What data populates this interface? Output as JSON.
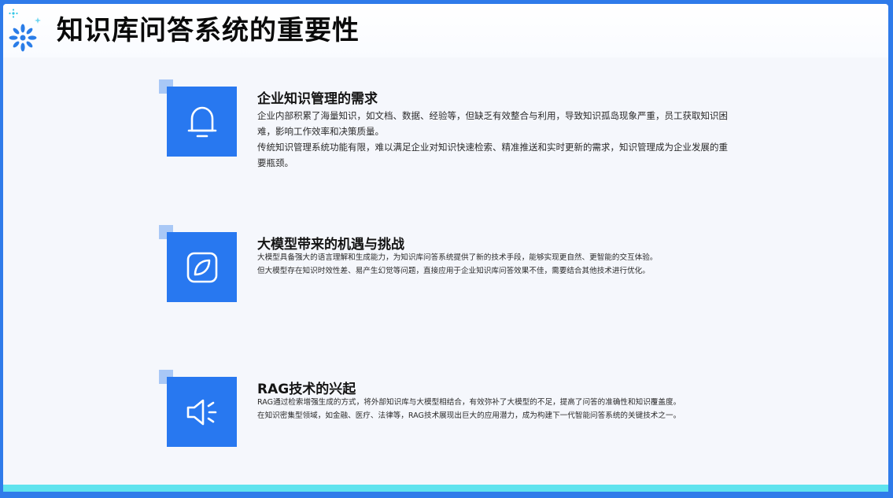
{
  "header": {
    "title": "知识库问答系统的重要性",
    "logo_icon": "sparkle-logo-icon"
  },
  "colors": {
    "accent": "#2878f0",
    "corner": "#a9c8f6",
    "frame": "#2f7bea",
    "bottom_bar": "#5fe3ee"
  },
  "sections": [
    {
      "icon": "bell-icon",
      "heading": "企业知识管理的需求",
      "paragraphs": [
        "企业内部积累了海量知识，如文档、数据、经验等，但缺乏有效整合与利用，导致知识孤岛现象严重，员工获取知识困难，影响工作效率和决策质量。",
        "传统知识管理系统功能有限，难以满足企业对知识快速检索、精准推送和实时更新的需求，知识管理成为企业发展的重要瓶颈。"
      ]
    },
    {
      "icon": "leaf-icon",
      "heading": "大模型带来的机遇与挑战",
      "paragraphs": [
        "大模型具备强大的语言理解和生成能力，为知识库问答系统提供了新的技术手段，能够实现更自然、更智能的交互体验。",
        "但大模型存在知识时效性差、易产生幻觉等问题，直接应用于企业知识库问答效果不佳，需要结合其他技术进行优化。"
      ]
    },
    {
      "icon": "speaker-icon",
      "heading": "RAG技术的兴起",
      "paragraphs": [
        "RAG通过检索增强生成的方式，将外部知识库与大模型相结合，有效弥补了大模型的不足，提高了问答的准确性和知识覆盖度。",
        "在知识密集型领域，如金融、医疗、法律等，RAG技术展现出巨大的应用潜力，成为构建下一代智能问答系统的关键技术之一。"
      ]
    }
  ]
}
